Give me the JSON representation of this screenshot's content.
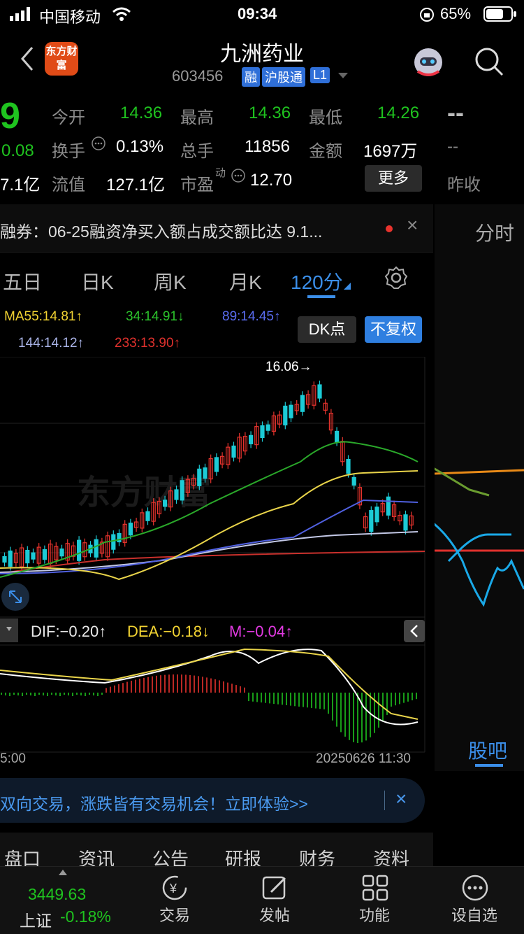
{
  "status": {
    "carrier": "中国移动",
    "time": "09:34",
    "battery": "65%"
  },
  "header": {
    "title": "九洲药业",
    "code": "603456",
    "badges": [
      "融",
      "沪股通",
      "L1"
    ],
    "logo": "东方财富"
  },
  "quote": {
    "price_fragment": "9",
    "change_fragment": "0.08",
    "cap_fragment": "7.1亿",
    "fields": [
      {
        "label": "今开",
        "value": "14.36"
      },
      {
        "label": "最高",
        "value": "14.36"
      },
      {
        "label": "最低",
        "value": "14.26"
      },
      {
        "label": "换手",
        "value": "0.13%"
      },
      {
        "label": "总手",
        "value": "11856"
      },
      {
        "label": "金额",
        "value": "1697万"
      },
      {
        "label": "流值",
        "value": "127.1亿"
      },
      {
        "label": "市盈",
        "sup": "动",
        "value": "12.70"
      }
    ],
    "more_label": "更多",
    "prev_close": {
      "dash_big": "--",
      "dash_small": "--",
      "label": "昨收"
    }
  },
  "notice": {
    "text": "融券：06-25融资净买入额占成交额比达 9.1...",
    "close": "×"
  },
  "periods": [
    "五日",
    "日K",
    "周K",
    "月K",
    "120分"
  ],
  "active_period": "120分",
  "settings_icon": "gear-icon",
  "ma": {
    "line1": [
      {
        "text": "MA55:14.81↑",
        "color": "#f2d332"
      },
      {
        "text": "34:14.91↓",
        "color": "#2cc52c"
      },
      {
        "text": "89:14.45↑",
        "color": "#5a6cf0"
      }
    ],
    "line2": [
      {
        "text": "144:14.12↑",
        "color": "#a9b3e6"
      },
      {
        "text": "233:13.90↑",
        "color": "#e0312d"
      }
    ],
    "dk_label": "DK点",
    "fq_label": "不复权"
  },
  "chart_annotation": "16.06→",
  "macd": {
    "dif": "DIF:−0.20↑",
    "dea": "DEA:−0.18↓",
    "m": "M:−0.04↑"
  },
  "axis": {
    "left_time": "5:00",
    "right_time": "20250626 11:30"
  },
  "right_panel": {
    "label_top": "分时",
    "label_bottom": "股吧"
  },
  "banner": {
    "text": "双向交易，涨跌皆有交易机会！立即体验>>",
    "close": "×"
  },
  "bottom_tabs": [
    "盘口",
    "资讯",
    "公告",
    "研报",
    "财务",
    "资料"
  ],
  "toolbar": {
    "index_value": "3449.63",
    "index_name": "上证",
    "index_change": "-0.18%",
    "items": [
      {
        "label": "交易",
        "icon": "yen-exchange-icon"
      },
      {
        "label": "发帖",
        "icon": "edit-icon"
      },
      {
        "label": "功能",
        "icon": "grid-icon"
      },
      {
        "label": "设自选",
        "icon": "more-dots-icon"
      }
    ]
  },
  "colors": {
    "up": "#e8332d",
    "down": "#1fc31f",
    "accent": "#2f7fe0"
  }
}
